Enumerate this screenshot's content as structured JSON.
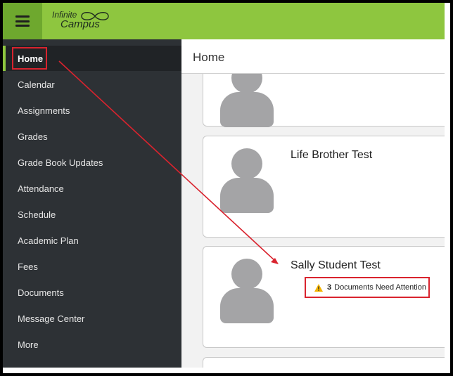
{
  "app": {
    "logo_line1": "Infinite",
    "logo_line2": "Campus"
  },
  "sidebar": {
    "items": [
      {
        "label": "Home",
        "active": true
      },
      {
        "label": "Calendar"
      },
      {
        "label": "Assignments"
      },
      {
        "label": "Grades"
      },
      {
        "label": "Grade Book Updates"
      },
      {
        "label": "Attendance"
      },
      {
        "label": "Schedule"
      },
      {
        "label": "Academic Plan"
      },
      {
        "label": "Fees"
      },
      {
        "label": "Documents"
      },
      {
        "label": "Message Center"
      },
      {
        "label": "More"
      }
    ]
  },
  "main": {
    "title": "Home",
    "students": [
      {
        "name": ""
      },
      {
        "name": "Life Brother Test"
      },
      {
        "name": "Sally Student Test",
        "attention": {
          "count": "3",
          "text": "Documents Need Attention"
        }
      }
    ]
  },
  "colors": {
    "topbar": "#8ec63f",
    "sidebar": "#2d3135",
    "annotation": "#d9232e",
    "warning": "#f4b400"
  },
  "icons": {
    "menu": "hamburger-icon",
    "warning": "warning-triangle-icon",
    "avatar": "person-silhouette-icon"
  }
}
